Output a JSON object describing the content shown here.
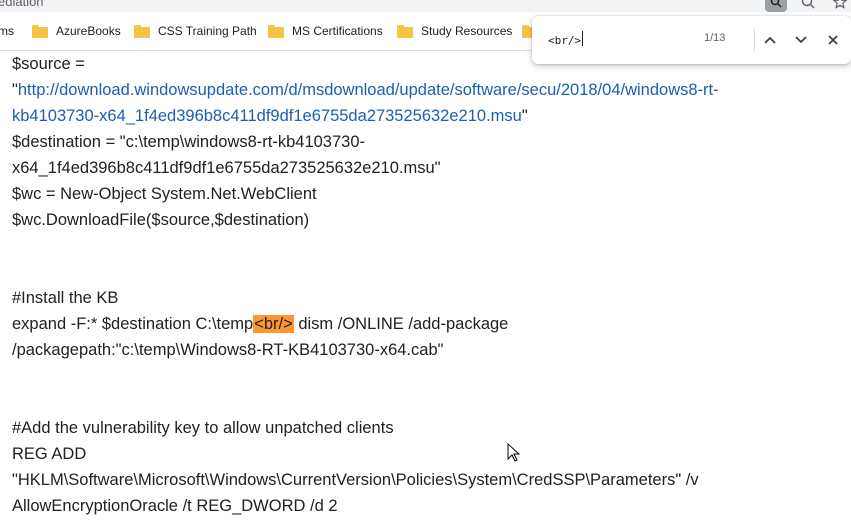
{
  "window": {
    "title": "ediation"
  },
  "bookmarks": {
    "items": [
      {
        "label": "ms"
      },
      {
        "label": "AzureBooks"
      },
      {
        "label": "CSS Training Path"
      },
      {
        "label": "MS Certifications"
      },
      {
        "label": "Study Resources"
      }
    ]
  },
  "content": {
    "lines": [
      {
        "text": "$source ="
      },
      {
        "open_quote": "\"",
        "link": "http://download.windowsupdate.com/d/msdownload/update/software/secu/2018/04/windows8-rt-"
      },
      {
        "link": "kb4103730-x64_1f4ed396b8c411df9df1e6755da273525632e210.msu",
        "close_quote": "\""
      },
      {
        "text": "$destination = \"c:\\temp\\windows8-rt-kb4103730-"
      },
      {
        "text": "x64_1f4ed396b8c411df9df1e6755da273525632e210.msu\""
      },
      {
        "text": "$wc = New-Object System.Net.WebClient"
      },
      {
        "text": "$wc.DownloadFile($source,$destination)"
      },
      {
        "text": "#Install the KB"
      },
      {
        "before": "expand -F:* $destination C:\\temp",
        "highlight": "<br/>",
        "after": " dism /ONLINE /add-package"
      },
      {
        "text": "/packagepath:\"c:\\temp\\Windows8-RT-KB4103730-x64.cab\""
      },
      {
        "text": "#Add the vulnerability key to allow unpatched clients"
      },
      {
        "text": "REG ADD"
      },
      {
        "text": "\"HKLM\\Software\\Microsoft\\Windows\\CurrentVersion\\Policies\\System\\CredSSP\\Parameters\" /v"
      },
      {
        "text": "AllowEncryptionOracle /t REG_DWORD /d 2"
      }
    ]
  },
  "find": {
    "query": "<br/>",
    "count": "1/13"
  },
  "icons": {
    "find_icon": "find-in-page-icon",
    "zoom_icon": "zoom-icon",
    "star_icon": "bookmark-star-icon",
    "up_icon": "chevron-up-icon",
    "down_icon": "chevron-down-icon",
    "close_icon": "close-icon"
  },
  "colors": {
    "link": "#1a5fb4",
    "highlight": "#ff9632",
    "folder": "#f6c445"
  }
}
